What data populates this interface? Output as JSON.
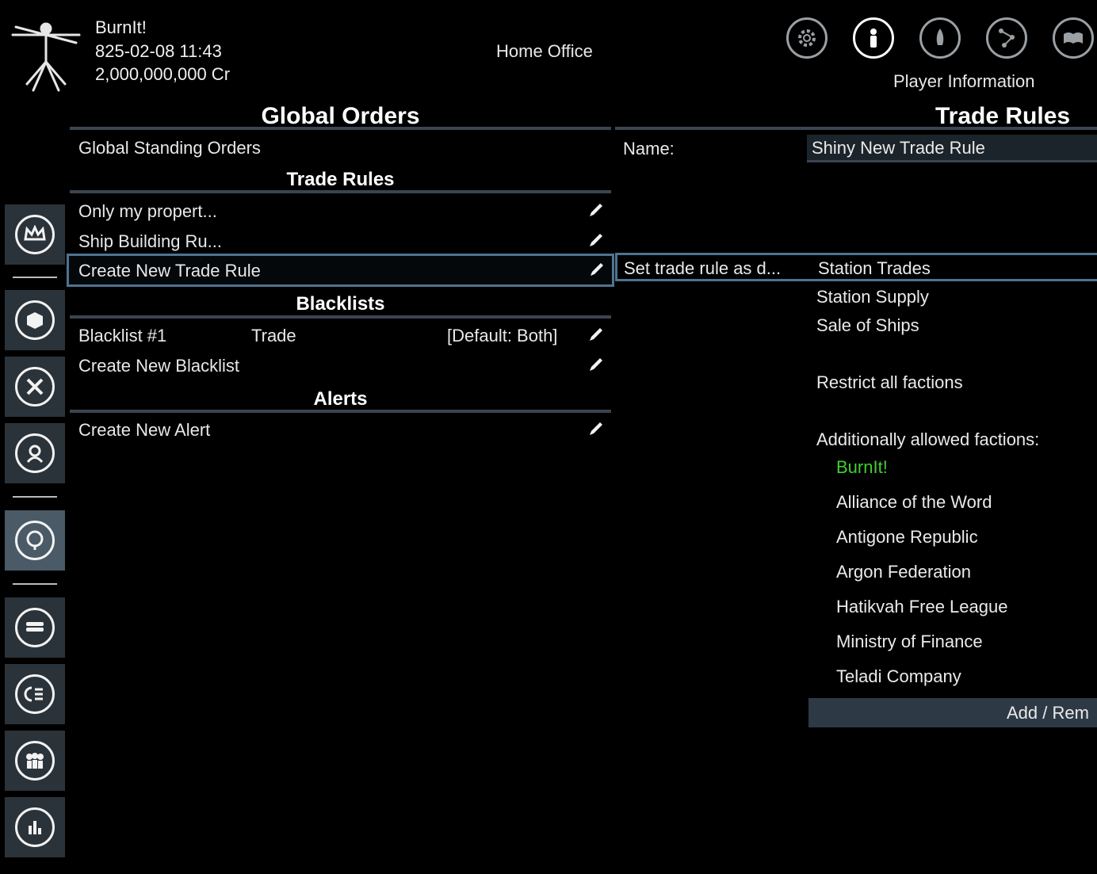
{
  "header": {
    "player_name": "BurnIt!",
    "datetime": "825-02-08 11:43",
    "credits": "2,000,000,000 Cr",
    "location": "Home Office",
    "section_label": "Player Information",
    "top_icons": [
      "gear-icon",
      "player-icon",
      "rocket-icon",
      "stars-icon",
      "book-icon"
    ]
  },
  "sidebar": {
    "icons": [
      "crown-icon",
      "cube-icon",
      "crossed-tools-icon",
      "person-icon",
      "globe-icon",
      "stack-icon",
      "list-icon",
      "people-icon",
      "bar-chart-icon"
    ],
    "active": "globe-icon"
  },
  "left": {
    "title": "Global Orders",
    "standing_orders": "Global Standing Orders",
    "trade_rules_title": "Trade Rules",
    "trade_rules": [
      {
        "label": "Only my propert..."
      },
      {
        "label": "Ship Building Ru..."
      },
      {
        "label": "Create New Trade Rule"
      }
    ],
    "blacklists_title": "Blacklists",
    "blacklist": {
      "name": "Blacklist #1",
      "type": "Trade",
      "default": "[Default: Both]"
    },
    "create_blacklist": "Create New Blacklist",
    "alerts_title": "Alerts",
    "create_alert": "Create New Alert"
  },
  "right": {
    "title": "Trade Rules",
    "name_label": "Name:",
    "name_value": "Shiny New Trade Rule",
    "set_default_label": "Set trade rule as d...",
    "defaults": [
      "Station Trades",
      "Station Supply",
      "Sale of Ships"
    ],
    "restrict": "Restrict all factions",
    "allowed_label": "Additionally allowed factions:",
    "factions": [
      "BurnIt!",
      "Alliance of the Word",
      "Antigone Republic",
      "Argon Federation",
      "Hatikvah Free League",
      "Ministry of Finance",
      "Teladi Company"
    ],
    "own_faction_color": "#3fcf2f",
    "add_remove": "Add / Rem"
  }
}
